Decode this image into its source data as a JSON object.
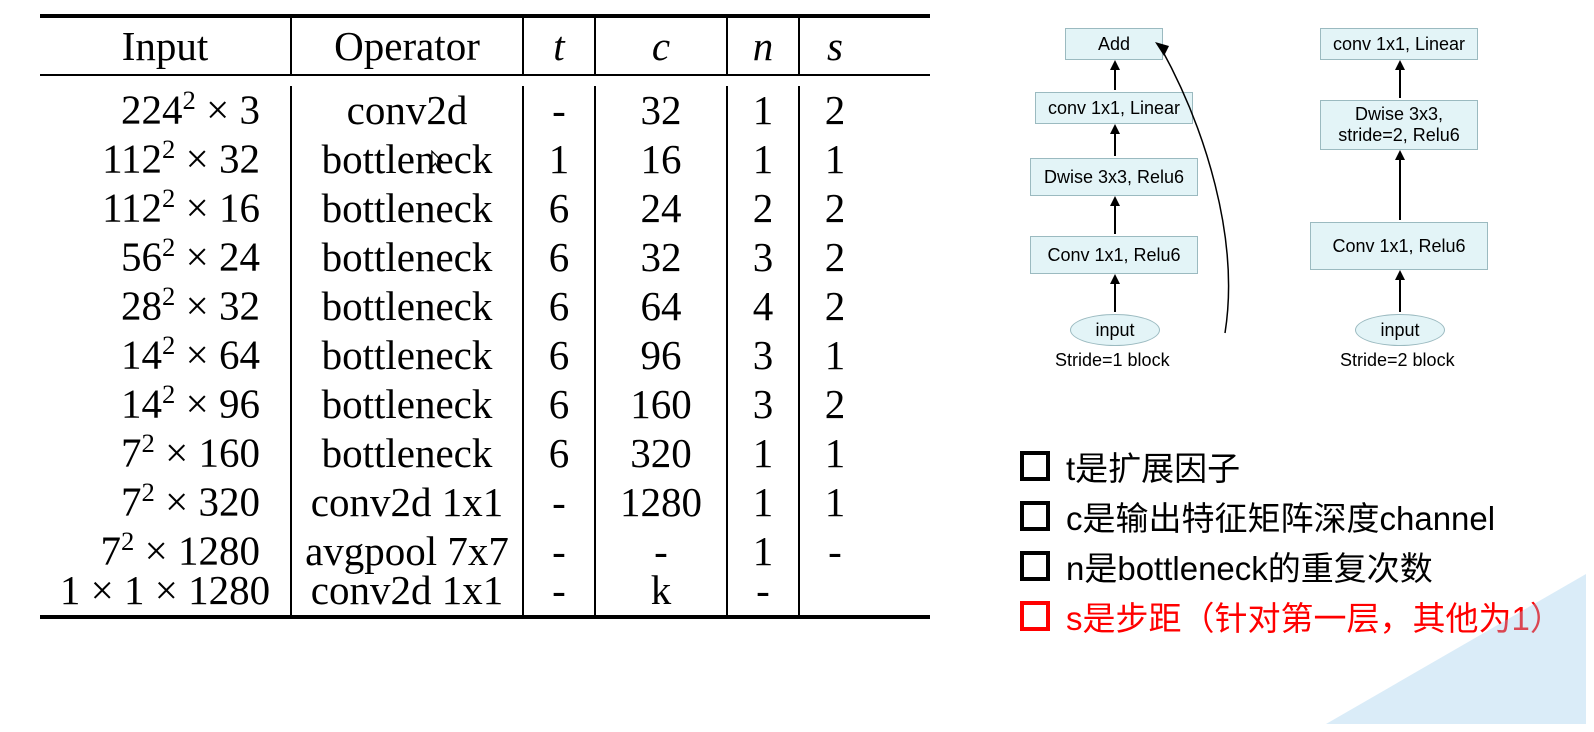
{
  "table": {
    "headers": {
      "input": "Input",
      "operator": "Operator",
      "t": "t",
      "c": "c",
      "n": "n",
      "s": "s"
    },
    "rows": [
      {
        "input_base": "224",
        "input_sup": "2",
        "input_tail": " × 3",
        "operator": "conv2d",
        "t": "-",
        "c": "32",
        "n": "1",
        "s": "2"
      },
      {
        "input_base": "112",
        "input_sup": "2",
        "input_tail": " × 32",
        "operator": "bottleneck",
        "t": "1",
        "c": "16",
        "n": "1",
        "s": "1"
      },
      {
        "input_base": "112",
        "input_sup": "2",
        "input_tail": " × 16",
        "operator": "bottleneck",
        "t": "6",
        "c": "24",
        "n": "2",
        "s": "2"
      },
      {
        "input_base": "56",
        "input_sup": "2",
        "input_tail": " × 24",
        "operator": "bottleneck",
        "t": "6",
        "c": "32",
        "n": "3",
        "s": "2"
      },
      {
        "input_base": "28",
        "input_sup": "2",
        "input_tail": " × 32",
        "operator": "bottleneck",
        "t": "6",
        "c": "64",
        "n": "4",
        "s": "2"
      },
      {
        "input_base": "14",
        "input_sup": "2",
        "input_tail": " × 64",
        "operator": "bottleneck",
        "t": "6",
        "c": "96",
        "n": "3",
        "s": "1"
      },
      {
        "input_base": "14",
        "input_sup": "2",
        "input_tail": " × 96",
        "operator": "bottleneck",
        "t": "6",
        "c": "160",
        "n": "3",
        "s": "2"
      },
      {
        "input_base": "7",
        "input_sup": "2",
        "input_tail": " × 160",
        "operator": "bottleneck",
        "t": "6",
        "c": "320",
        "n": "1",
        "s": "1"
      },
      {
        "input_base": "7",
        "input_sup": "2",
        "input_tail": " × 320",
        "operator": "conv2d 1x1",
        "t": "-",
        "c": "1280",
        "n": "1",
        "s": "1"
      },
      {
        "input_base": "7",
        "input_sup": "2",
        "input_tail": " × 1280",
        "operator": "avgpool 7x7",
        "t": "-",
        "c": "-",
        "n": "1",
        "s": "-"
      },
      {
        "input_base": "1 × 1 × 1280",
        "input_sup": "",
        "input_tail": "",
        "operator": "conv2d 1x1",
        "t": "-",
        "c": "k",
        "n": "-",
        "s": ""
      }
    ]
  },
  "diagram": {
    "left": {
      "add": "Add",
      "conv_linear": "conv 1x1, Linear",
      "dwise": "Dwise 3x3, Relu6",
      "conv_relu": "Conv 1x1, Relu6",
      "input": "input",
      "caption": "Stride=1 block"
    },
    "right": {
      "conv_linear": "conv 1x1, Linear",
      "dwise": "Dwise 3x3,\nstride=2, Relu6",
      "conv_relu": "Conv 1x1, Relu6",
      "input": "input",
      "caption": "Stride=2 block"
    }
  },
  "legend": {
    "t": "t是扩展因子",
    "c": "c是输出特征矩阵深度channel",
    "n": "n是bottleneck的重复次数",
    "s": "s是步距（针对第一层，其他为1）"
  }
}
